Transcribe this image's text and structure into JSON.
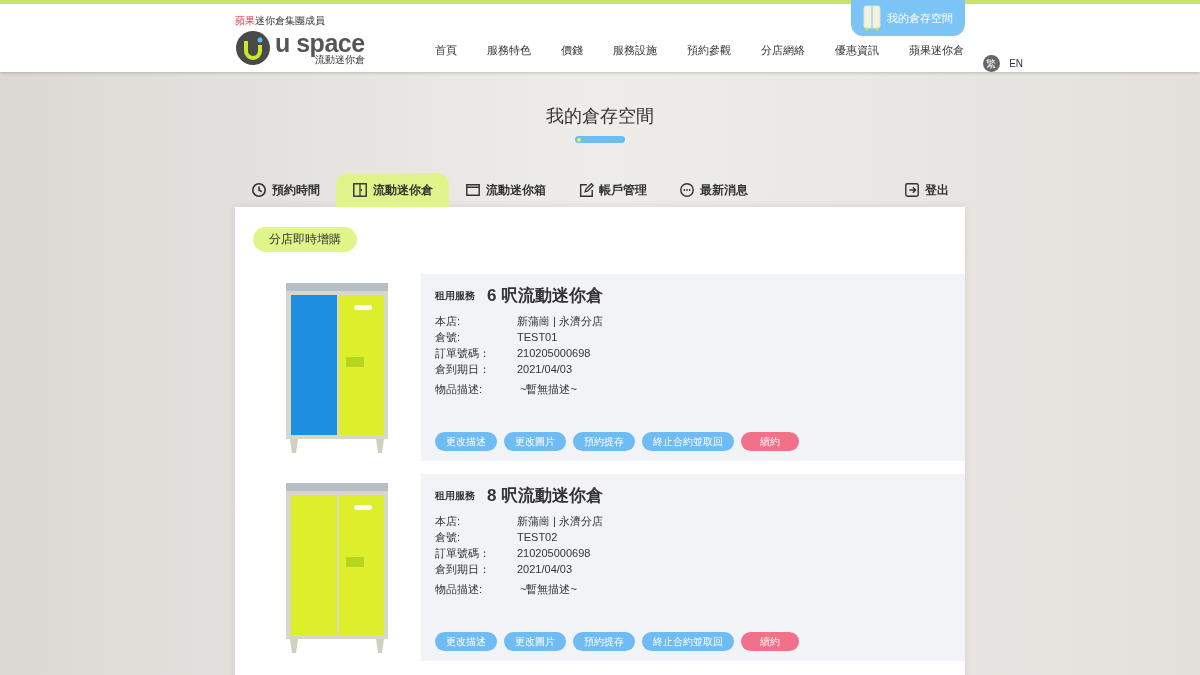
{
  "header": {
    "tagline_brand": "蘋果",
    "tagline_rest": "迷你倉集團成員",
    "logo_text": "u space",
    "logo_subtext": "流動迷你倉",
    "account_button": "我的倉存空間",
    "nav": [
      "首頁",
      "服務特色",
      "價錢",
      "服務設施",
      "預約參觀",
      "分店網絡",
      "優惠資訊",
      "蘋果迷你倉"
    ],
    "languages": [
      {
        "label": "繁",
        "selected": true
      },
      {
        "label": "EN",
        "selected": false
      }
    ]
  },
  "page_title": "我的倉存空間",
  "tabs": [
    {
      "label": "預約時間",
      "selected": false
    },
    {
      "label": "流動迷你倉",
      "selected": true
    },
    {
      "label": "流動迷你箱",
      "selected": false
    },
    {
      "label": "帳戶管理",
      "selected": false
    },
    {
      "label": "最新消息",
      "selected": false
    }
  ],
  "logout": "登出",
  "add_button": "分店即時增購",
  "units": [
    {
      "service_label": "租用服務",
      "title": "6 呎流動迷你倉",
      "color": "#1e8fe0",
      "fields": [
        {
          "label": "本店:",
          "value": "新蒲崗 | 永濟分店"
        },
        {
          "label": "倉號:",
          "value": "TEST01"
        },
        {
          "label": "訂單號碼：",
          "value": "210205000698"
        },
        {
          "label": "倉到期日：",
          "value": "2021/04/03"
        }
      ],
      "description_label": "物品描述:",
      "description": "~暫無描述~",
      "actions": [
        {
          "label": "更改描述",
          "kind": "normal"
        },
        {
          "label": "更改圖片",
          "kind": "normal"
        },
        {
          "label": "預約提存",
          "kind": "normal"
        },
        {
          "label": "終止合約並取回",
          "kind": "normal"
        },
        {
          "label": "續約",
          "kind": "renew"
        }
      ]
    },
    {
      "service_label": "租用服務",
      "title": "8 呎流動迷你倉",
      "color": "#dcef2a",
      "fields": [
        {
          "label": "本店:",
          "value": "新蒲崗 | 永濟分店"
        },
        {
          "label": "倉號:",
          "value": "TEST02"
        },
        {
          "label": "訂單號碼：",
          "value": "210205000698"
        },
        {
          "label": "倉到期日：",
          "value": "2021/04/03"
        }
      ],
      "description_label": "物品描述:",
      "description": "~暫無描述~",
      "actions": [
        {
          "label": "更改描述",
          "kind": "normal"
        },
        {
          "label": "更改圖片",
          "kind": "normal"
        },
        {
          "label": "預約提存",
          "kind": "normal"
        },
        {
          "label": "終止合約並取回",
          "kind": "normal"
        },
        {
          "label": "續約",
          "kind": "renew"
        }
      ]
    }
  ]
}
